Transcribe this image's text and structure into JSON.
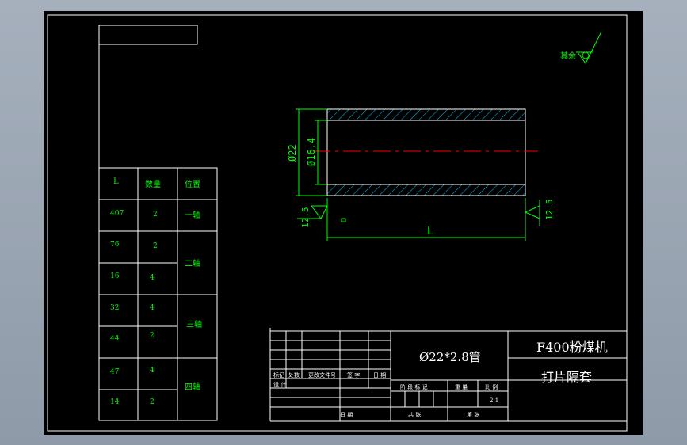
{
  "part_name": "Ø22*2.8管",
  "machine_title": "F400粉煤机",
  "part_title": "打片隔套",
  "surface_finish_note": "其余",
  "dimensions": {
    "outer_diameter": "Ø22",
    "inner_diameter": "Ø16.4",
    "length": "L",
    "roughness_left": "12.5",
    "roughness_right": "12.5"
  },
  "length_table": {
    "headers": [
      "L",
      "数量",
      "位置"
    ],
    "rows": [
      {
        "L": "407",
        "qty": "2",
        "position": "一轴"
      },
      {
        "L": "76",
        "qty": "2",
        "position": "二轴"
      },
      {
        "L": "16",
        "qty": "4",
        "position": ""
      },
      {
        "L": "32",
        "qty": "4",
        "position": "三轴"
      },
      {
        "L": "44",
        "qty": "2",
        "position": ""
      },
      {
        "L": "47",
        "qty": "4",
        "position": "四轴"
      },
      {
        "L": "14",
        "qty": "2",
        "position": ""
      }
    ]
  },
  "title_block": {
    "labels": {
      "mark": "标记",
      "count": "处数",
      "change_doc": "更改文件号",
      "signature": "签 字",
      "date": "日 期",
      "design": "设 计",
      "stage_mark": "阶 段 标 记",
      "weight": "重 量",
      "scale": "比 例",
      "scale_value": "2:1",
      "review": "共 张",
      "sheet": "第 张",
      "date2": "日 期"
    }
  },
  "colors": {
    "background": "#000000",
    "lines": "#ffffff",
    "dimension": "#00ff00",
    "hatch": "#00c8ff",
    "centerline": "#ff0000"
  }
}
